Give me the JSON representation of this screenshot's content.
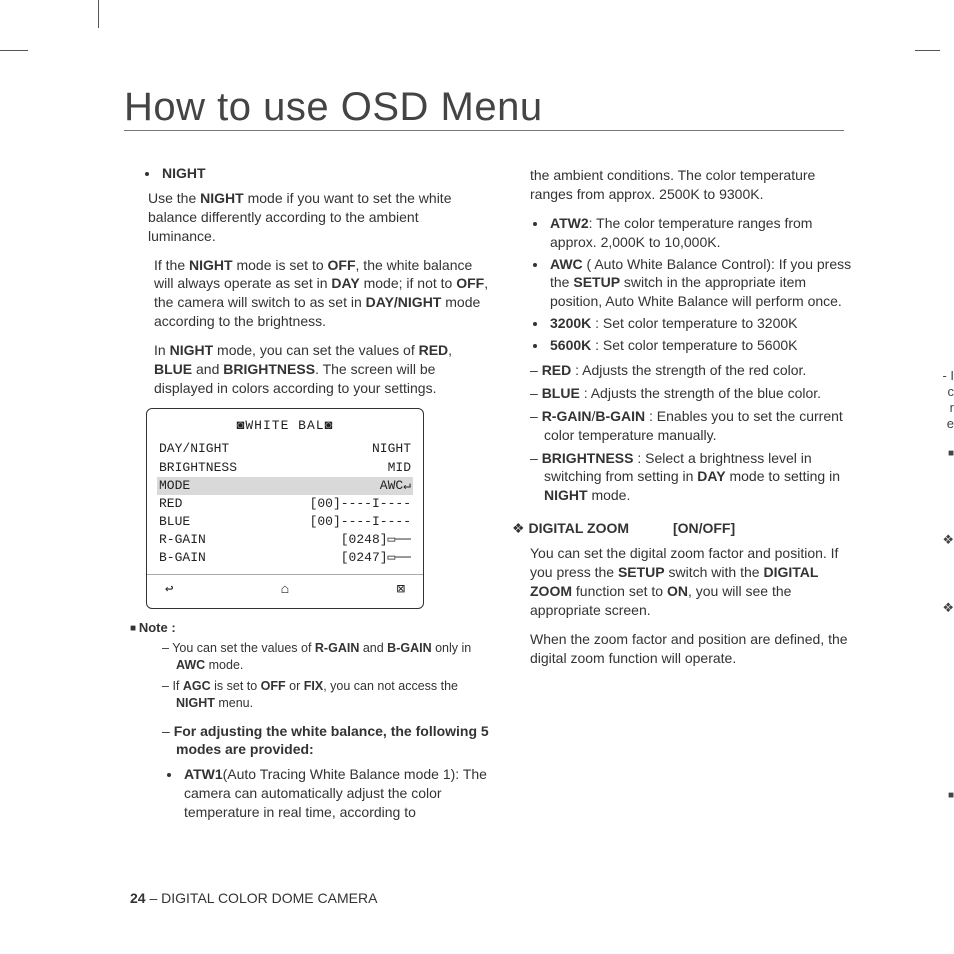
{
  "page_title": "How to use OSD Menu",
  "left": {
    "night_heading": "NIGHT",
    "night_p1_a": "Use the ",
    "night_p1_b": "NIGHT",
    "night_p1_c": " mode if you want to set the white balance differently according to the ambient luminance.",
    "night_p2": "If the NIGHT mode is set to OFF, the white balance will always operate as set in DAY mode; if not to OFF, the camera will switch to as set in DAY/NIGHT mode according to the brightness.",
    "night_p3": "In NIGHT mode, you can set the values of RED, BLUE and BRIGHTNESS. The screen will be displayed in colors according to your settings.",
    "osd": {
      "title": "◙WHITE BAL◙",
      "rows": [
        {
          "l": "DAY/NIGHT",
          "r": "NIGHT",
          "hl": false
        },
        {
          "l": "BRIGHTNESS",
          "r": "MID",
          "hl": false
        },
        {
          "l": "MODE",
          "r": "AWC↵",
          "hl": true
        },
        {
          "l": " RED",
          "r": "[00]----I----",
          "hl": false
        },
        {
          "l": " BLUE",
          "r": "[00]----I----",
          "hl": false
        },
        {
          "l": " R-GAIN",
          "r": "[0248]▭──",
          "hl": false
        },
        {
          "l": " B-GAIN",
          "r": "[0247]▭──",
          "hl": false
        }
      ],
      "icons": {
        "back": "↩",
        "home": "⌂",
        "close": "⊠"
      }
    },
    "note_label": "Note :",
    "note_1": "You can set the values of R-GAIN and B-GAIN only in AWC mode.",
    "note_2": "If AGC is set to OFF or FIX, you can not access the NIGHT menu.",
    "adjust_head": "For adjusting the white balance, the following 5 modes are provided:",
    "atw1": "ATW1(Auto Tracing White Balance mode 1): The camera can automatically adjust the color temperature in real time, according to"
  },
  "right": {
    "cont": "the ambient conditions. The color temperature ranges from approx. 2500K to 9300K.",
    "atw2": "ATW2: The color temperature ranges from approx. 2,000K to 10,000K.",
    "awc": "AWC ( Auto White Balance Control): If you press the SETUP switch in the appropriate item position, Auto White Balance will perform once.",
    "k3200": "3200K : Set color temperature to 3200K",
    "k5600": "5600K : Set color temperature to 5600K",
    "red": "RED : Adjusts the strength of the red color.",
    "blue": "BLUE : Adjusts the strength of the blue color.",
    "gain": "R-GAIN/B-GAIN : Enables you to set the current color temperature manually.",
    "brightness": "BRIGHTNESS : Select a brightness level in switching from setting in DAY mode to setting in NIGHT mode.",
    "dz_head_l": "DIGITAL ZOOM",
    "dz_head_r": "[ON/OFF]",
    "dz_p1": "You can set the digital zoom factor and position. If you press the SETUP switch with the DIGITAL ZOOM function set to ON, you will see the appropriate screen.",
    "dz_p2": "When the zoom factor and position are defined, the digital zoom function will operate."
  },
  "footer": {
    "page_no": "24",
    "sep": " – ",
    "book": "DIGITAL COLOR DOME CAMERA"
  },
  "edge_marks": {
    "m1": "- I",
    "m2": "c",
    "m3": "r",
    "m4": "e",
    "sq": "■",
    "di1": "❖",
    "di2": "❖"
  }
}
